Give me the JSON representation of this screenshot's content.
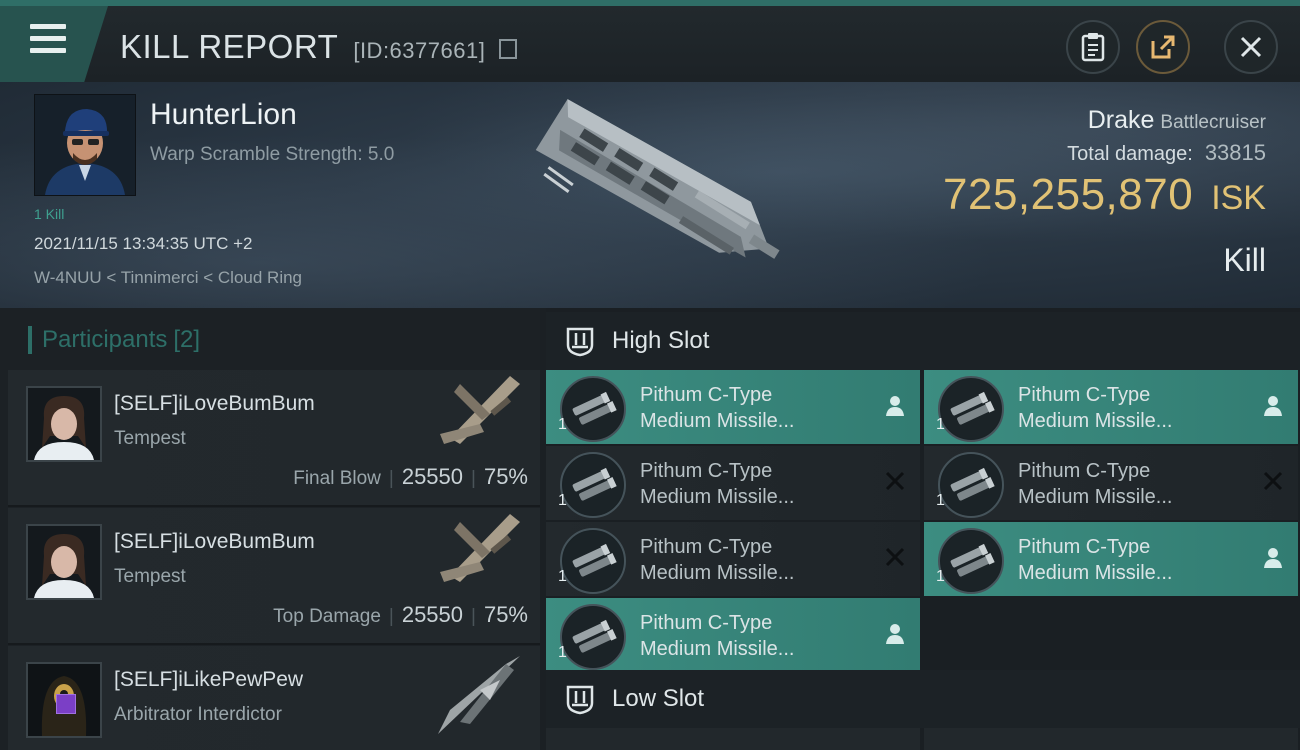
{
  "header": {
    "title": "KILL REPORT",
    "id_label": "[ID:6377661]",
    "menu_icon": "hamburger-icon",
    "buttons": [
      {
        "name": "clipboard-button",
        "icon": "clipboard-icon"
      },
      {
        "name": "share-button",
        "icon": "share-icon"
      },
      {
        "name": "close-button",
        "icon": "close-icon"
      }
    ]
  },
  "victim": {
    "name": "HunterLion",
    "subtitle": "Warp Scramble Strength: 5.0",
    "kill_tag": "1 Kill",
    "datetime": "2021/11/15 13:34:35 UTC +2",
    "location": "W-4NUU < Tinnimerci < Cloud Ring",
    "ship_name": "Drake",
    "ship_class": "Battlecruiser",
    "total_damage_label": "Total damage:",
    "total_damage": "33815",
    "isk_value": "725,255,870",
    "isk_unit": "ISK",
    "result": "Kill"
  },
  "participants": {
    "label": "Participants",
    "count": "[2]",
    "rows": [
      {
        "name": "[SELF]iLoveBumBum",
        "ship": "Tempest",
        "role": "Final Blow",
        "damage": "25550",
        "percent": "75%"
      },
      {
        "name": "[SELF]iLoveBumBum",
        "ship": "Tempest",
        "role": "Top Damage",
        "damage": "25550",
        "percent": "75%"
      },
      {
        "name": "[SELF]iLikePewPew",
        "ship": "Arbitrator Interdictor"
      }
    ]
  },
  "high_slot": {
    "label": "High Slot",
    "modules": [
      {
        "line1": "Pithum C-Type",
        "line2": "Medium Missile...",
        "qty": "1",
        "state": "dropped"
      },
      {
        "line1": "Pithum C-Type",
        "line2": "Medium Missile...",
        "qty": "1",
        "state": "dropped"
      },
      {
        "line1": "Pithum C-Type",
        "line2": "Medium Missile...",
        "qty": "1",
        "state": "destroyed"
      },
      {
        "line1": "Pithum C-Type",
        "line2": "Medium Missile...",
        "qty": "1",
        "state": "destroyed"
      },
      {
        "line1": "Pithum C-Type",
        "line2": "Medium Missile...",
        "qty": "1",
        "state": "destroyed"
      },
      {
        "line1": "Pithum C-Type",
        "line2": "Medium Missile...",
        "qty": "1",
        "state": "dropped"
      },
      {
        "line1": "Pithum C-Type",
        "line2": "Medium Missile...",
        "qty": "1",
        "state": "dropped"
      }
    ]
  },
  "low_slot": {
    "label": "Low Slot"
  },
  "colors": {
    "accent_teal": "#3c8d81",
    "isk_gold": "#e1c275",
    "participants_header": "#2d6f68"
  }
}
